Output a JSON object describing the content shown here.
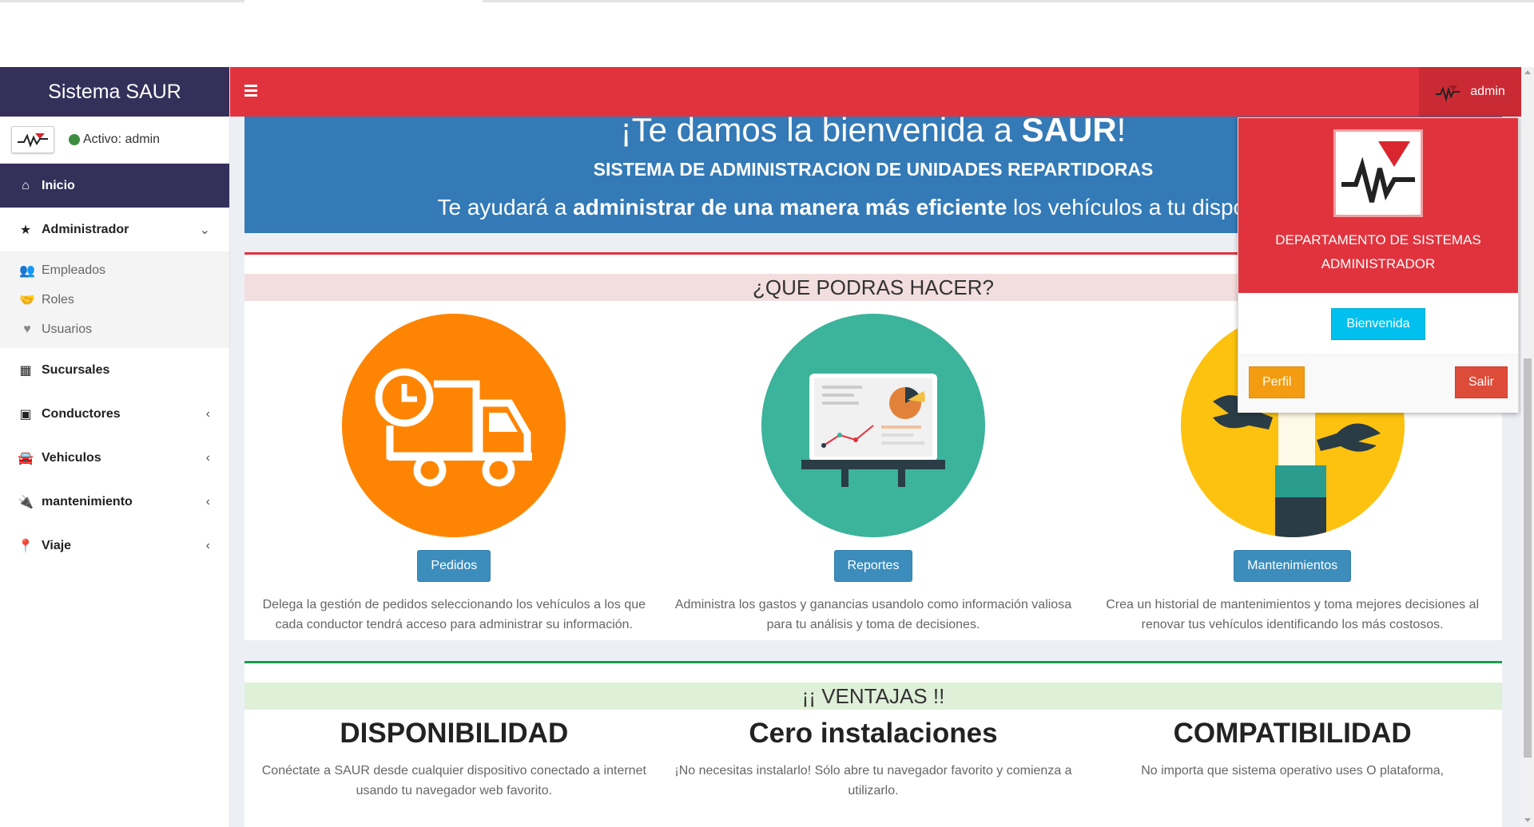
{
  "app": {
    "title": "Sistema SAUR"
  },
  "user": {
    "status": "Activo: admin",
    "name": "admin"
  },
  "sidebar": {
    "items": [
      {
        "label": "Inicio"
      },
      {
        "label": "Administrador"
      },
      {
        "label": "Sucursales"
      },
      {
        "label": "Conductores"
      },
      {
        "label": "Vehiculos"
      },
      {
        "label": "mantenimiento"
      },
      {
        "label": "Viaje"
      }
    ],
    "subitems": [
      {
        "label": "Empleados"
      },
      {
        "label": "Roles"
      },
      {
        "label": "Usuarios"
      }
    ]
  },
  "hero": {
    "title_prefix": "¡Te damos la bienvenida a ",
    "title_brand": "SAUR",
    "title_suffix": "!",
    "subtitle": "SISTEMA DE ADMINISTRACION DE UNIDADES REPARTIDORAS",
    "desc_prefix": "Te ayudará a ",
    "desc_bold": "administrar de una manera más eficiente",
    "desc_suffix": " los vehículos a tu disposición."
  },
  "features": {
    "heading": "¿QUE PODRAS HACER?",
    "cards": [
      {
        "button": "Pedidos",
        "text": "Delega la gestión de pedidos seleccionando los vehículos a los que cada conductor tendrá acceso para administrar su información."
      },
      {
        "button": "Reportes",
        "text": "Administra los gastos y ganancias usandolo como información valiosa para tu análisis y toma de decisiones."
      },
      {
        "button": "Mantenimientos",
        "text": "Crea un historial de mantenimientos y toma mejores decisiones al renovar tus vehículos identificando los más costosos."
      }
    ]
  },
  "advantages": {
    "heading": "¡¡ VENTAJAS !!",
    "items": [
      {
        "title": "DISPONIBILIDAD",
        "text": "Conéctate a SAUR desde cualquier dispositivo conectado a internet usando tu navegador web favorito."
      },
      {
        "title": "Cero instalaciones",
        "text": "¡No necesitas instalarlo! Sólo abre tu navegador favorito y comienza a utilizarlo."
      },
      {
        "title": "COMPATIBILIDAD",
        "text": "No importa que sistema operativo uses O plataforma,"
      }
    ]
  },
  "dropdown": {
    "department_line1": "DEPARTAMENTO DE SISTEMAS",
    "department_line2": "ADMINISTRADOR",
    "welcome_button": "Bienvenida",
    "profile_button": "Perfil",
    "logout_button": "Salir"
  },
  "colors": {
    "brand_dark": "#34305a",
    "header_red": "#e1333d",
    "hero_blue": "#337ab7"
  }
}
